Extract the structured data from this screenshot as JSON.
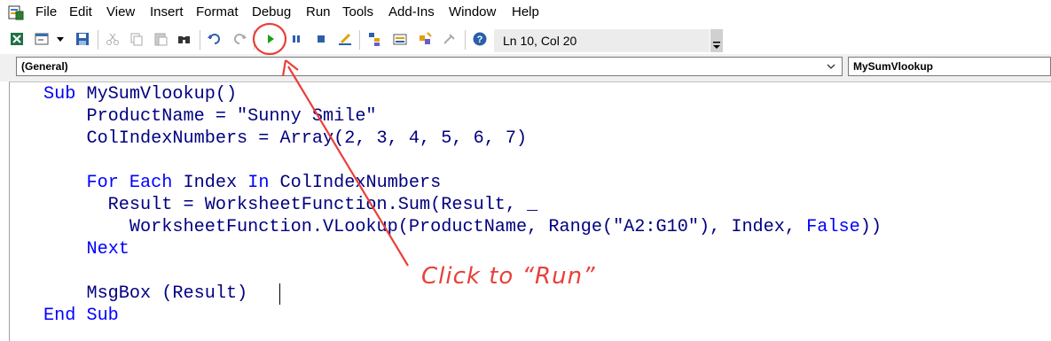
{
  "menu": {
    "items": [
      "File",
      "Edit",
      "View",
      "Insert",
      "Format",
      "Debug",
      "Run",
      "Tools",
      "Add-Ins",
      "Window",
      "Help"
    ]
  },
  "toolbar": {
    "icons": [
      "excel-view-icon",
      "insert-userform-icon",
      "dropdown-arrow-icon",
      "save-icon",
      "cut-icon",
      "copy-icon",
      "paste-icon",
      "find-icon",
      "undo-icon",
      "redo-icon",
      "run-icon",
      "break-icon",
      "reset-icon",
      "design-mode-icon",
      "project-explorer-icon",
      "properties-icon",
      "object-browser-icon",
      "toolbox-icon",
      "help-icon"
    ],
    "status": "Ln 10, Col 20"
  },
  "object_bar": {
    "object_combo": "(General)",
    "procedure_combo": "MySumVlookup"
  },
  "code": {
    "lines": [
      {
        "kw": "Sub",
        "rest": " MySumVlookup()"
      },
      {
        "kw": "",
        "rest": "    ProductName = \"Sunny Smile\""
      },
      {
        "kw": "",
        "rest": "    ColIndexNumbers = Array(2, 3, 4, 5, 6, 7)"
      },
      {
        "kw": "",
        "rest": ""
      },
      {
        "kw": "For Each",
        "pre": "    ",
        "mid": " Index ",
        "kw2": "In",
        "rest": " ColIndexNumbers"
      },
      {
        "kw": "",
        "rest": "      Result = WorksheetFunction.Sum(Result, _"
      },
      {
        "kw": "",
        "rest": "        WorksheetFunction.VLookup(ProductName, Range(\"A2:G10\"), Index, ",
        "kw2": "False",
        "tail": "))"
      },
      {
        "kw": "Next",
        "pre": "    ",
        "rest": ""
      },
      {
        "kw": "",
        "rest": ""
      },
      {
        "kw": "",
        "rest": "    MsgBox (Result)"
      },
      {
        "kw": "End Sub",
        "rest": ""
      }
    ]
  },
  "annotation": {
    "text": "Click to “Run”",
    "color": "#e8403a"
  },
  "colors": {
    "keyword": "#0000ff",
    "code_text": "#000080",
    "run_button": "#1a9e1a",
    "annotation": "#e8403a"
  }
}
